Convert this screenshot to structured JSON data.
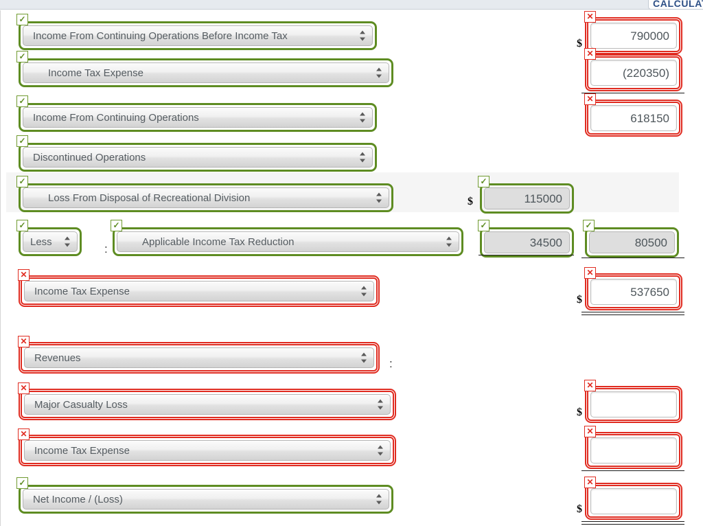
{
  "toolbar": {
    "calculate_label": "CALCULATE"
  },
  "icons": {
    "ok": "✓",
    "err": "✕",
    "dollar": "$",
    "colon": ":"
  },
  "colors": {
    "ok_green": "#5e8c22",
    "error_red": "#e02b20",
    "shaded_row": "#f5f5f5",
    "calculate_text": "#2d4f86"
  },
  "rows": [
    {
      "id": "income-before-tax",
      "account_label": "Income From Continuing Operations Before Income Tax",
      "account_state": "ok",
      "amount_value": "790000",
      "amount_state": "err",
      "dollar": true,
      "underline": "none"
    },
    {
      "id": "income-tax-expense-1",
      "account_label": "Income Tax Expense",
      "account_state": "ok",
      "amount_value": "(220350)",
      "amount_state": "err",
      "dollar": false,
      "underline": "single"
    },
    {
      "id": "income-from-continuing-operations",
      "account_label": "Income From Continuing Operations",
      "account_state": "ok",
      "amount_value": "618150",
      "amount_state": "err",
      "dollar": false,
      "underline": "none"
    },
    {
      "id": "discontinued-operations",
      "account_label": "Discontinued Operations",
      "account_state": "ok",
      "amount_value": null,
      "amount_state": null,
      "dollar": false,
      "underline": "none"
    },
    {
      "id": "loss-from-disposal",
      "account_label": "Loss From Disposal of Recreational Division",
      "account_state": "ok",
      "mid_value": "115000",
      "mid_state": "ok",
      "mid_dollar": true,
      "amount_value": null,
      "amount_state": null,
      "dollar": false,
      "underline": "none",
      "shaded": true
    },
    {
      "id": "applicable-income-tax-reduction",
      "prefix_label": "Less",
      "prefix_state": "ok",
      "account_label": "Applicable Income Tax Reduction",
      "account_state": "ok",
      "mid_value": "34500",
      "mid_state": "ok",
      "mid_underline": "single",
      "amount_value": "80500",
      "amount_state": "ok",
      "dollar": false,
      "underline": "single"
    },
    {
      "id": "income-tax-expense-2",
      "account_label": "Income Tax Expense",
      "account_state": "err",
      "amount_value": "537650",
      "amount_state": "err",
      "dollar": true,
      "underline": "double"
    },
    {
      "id": "revenues",
      "account_label": "Revenues",
      "account_state": "err",
      "trailing_colon": true,
      "amount_value": null,
      "amount_state": null,
      "dollar": false,
      "underline": "none"
    },
    {
      "id": "major-casualty-loss",
      "account_label": "Major Casualty Loss",
      "account_state": "err",
      "amount_value": "",
      "amount_state": "err",
      "dollar": true,
      "underline": "none"
    },
    {
      "id": "income-tax-expense-3",
      "account_label": "Income Tax Expense",
      "account_state": "err",
      "amount_value": "",
      "amount_state": "err",
      "dollar": false,
      "underline": "single"
    },
    {
      "id": "net-income-loss",
      "account_label": "Net Income / (Loss)",
      "account_state": "ok",
      "amount_value": "",
      "amount_state": "err",
      "dollar": true,
      "underline": "double"
    }
  ]
}
